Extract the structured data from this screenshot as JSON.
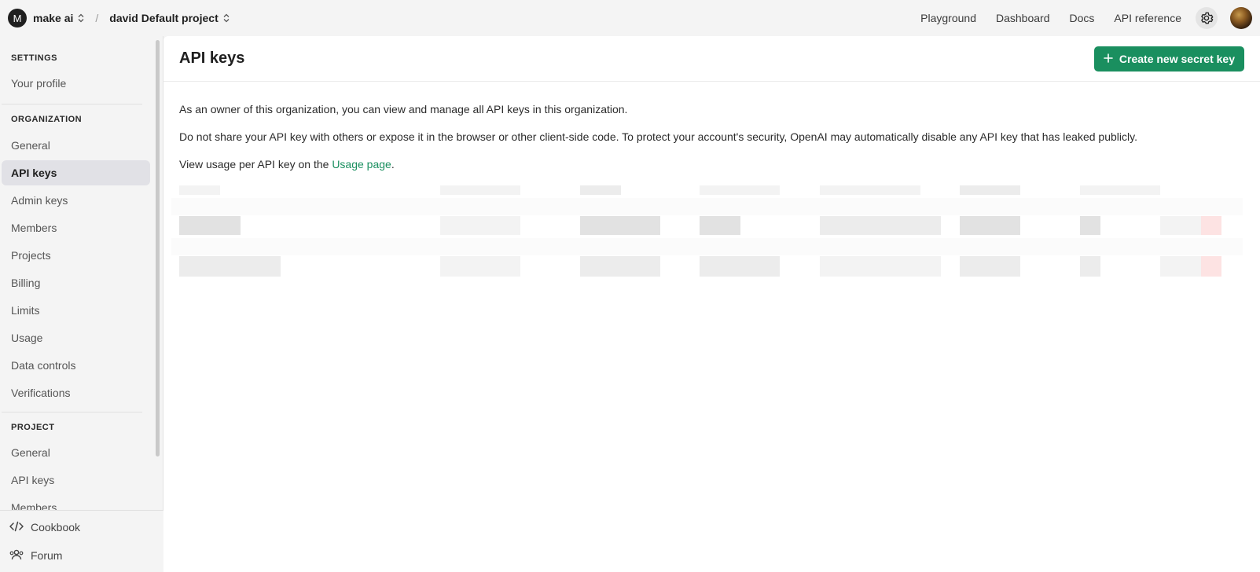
{
  "topbar": {
    "org_initial": "M",
    "org_name": "make ai",
    "separator": "/",
    "project_name": "david Default project",
    "nav": [
      "Playground",
      "Dashboard",
      "Docs",
      "API reference"
    ]
  },
  "sidebar": {
    "settings_heading": "SETTINGS",
    "settings_items": [
      "Your profile"
    ],
    "organization_heading": "ORGANIZATION",
    "organization_items": [
      "General",
      "API keys",
      "Admin keys",
      "Members",
      "Projects",
      "Billing",
      "Limits",
      "Usage",
      "Data controls",
      "Verifications"
    ],
    "project_heading": "PROJECT",
    "project_items": [
      "General",
      "API keys",
      "Members"
    ],
    "bottom_links": [
      "Cookbook",
      "Forum"
    ]
  },
  "main": {
    "title": "API keys",
    "create_button": "Create new secret key",
    "para1": "As an owner of this organization, you can view and manage all API keys in this organization.",
    "para2": "Do not share your API key with others or expose it in the browser or other client-side code. To protect your account's security, OpenAI may automatically disable any API key that has leaked publicly.",
    "para3_prefix": "View usage per API key on the ",
    "para3_link": "Usage page",
    "para3_suffix": "."
  },
  "colors": {
    "accent": "#1a8f5f",
    "active_item_bg": "#e1e1e6"
  }
}
